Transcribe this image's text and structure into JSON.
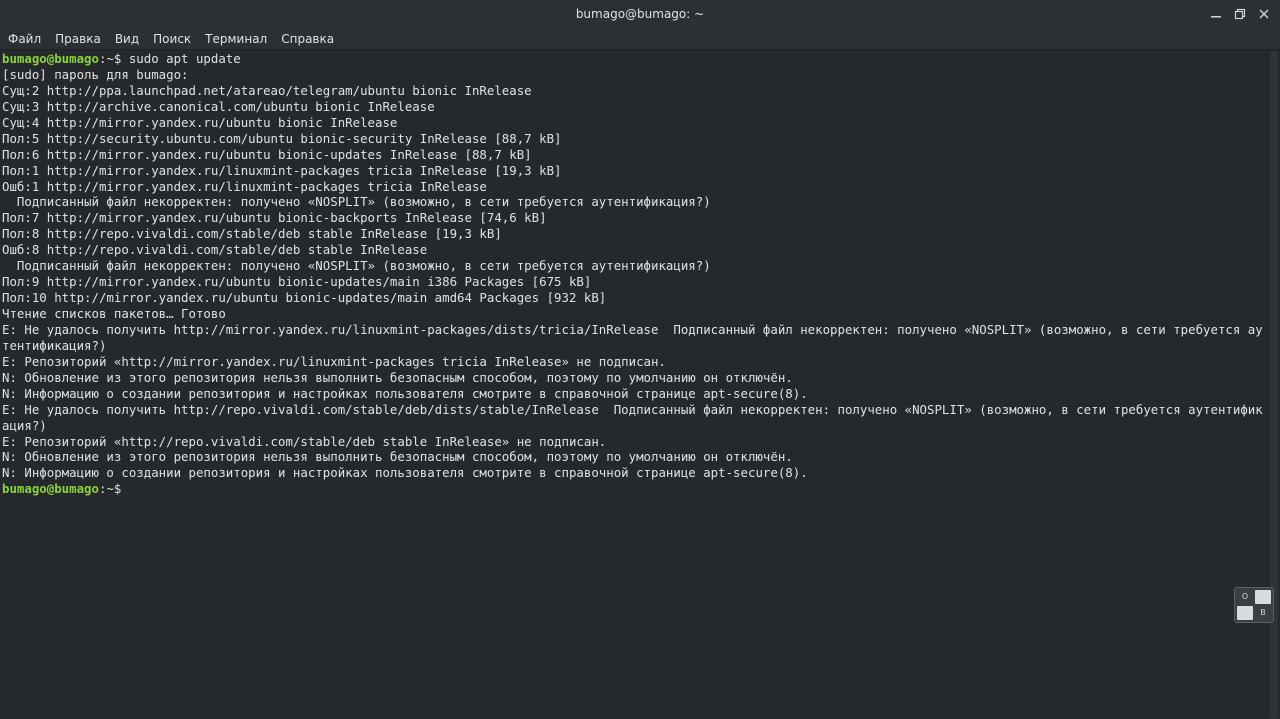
{
  "window": {
    "title": "bumago@bumago: ~"
  },
  "menu": {
    "items": [
      "Файл",
      "Правка",
      "Вид",
      "Поиск",
      "Терминал",
      "Справка"
    ]
  },
  "terminal": {
    "prompt_user": "bumago@bumago",
    "prompt_path": ":~$",
    "command": " sudo apt update",
    "output": [
      "[sudo] пароль для bumago:",
      "Сущ:2 http://ppa.launchpad.net/atareao/telegram/ubuntu bionic InRelease",
      "Сущ:3 http://archive.canonical.com/ubuntu bionic InRelease",
      "Сущ:4 http://mirror.yandex.ru/ubuntu bionic InRelease",
      "Пол:5 http://security.ubuntu.com/ubuntu bionic-security InRelease [88,7 kB]",
      "Пол:6 http://mirror.yandex.ru/ubuntu bionic-updates InRelease [88,7 kB]",
      "Пол:1 http://mirror.yandex.ru/linuxmint-packages tricia InRelease [19,3 kB]",
      "Ошб:1 http://mirror.yandex.ru/linuxmint-packages tricia InRelease",
      "  Подписанный файл некорректен: получено «NOSPLIT» (возможно, в сети требуется аутентификация?)",
      "Пол:7 http://mirror.yandex.ru/ubuntu bionic-backports InRelease [74,6 kB]",
      "Пол:8 http://repo.vivaldi.com/stable/deb stable InRelease [19,3 kB]",
      "Ошб:8 http://repo.vivaldi.com/stable/deb stable InRelease",
      "  Подписанный файл некорректен: получено «NOSPLIT» (возможно, в сети требуется аутентификация?)",
      "Пол:9 http://mirror.yandex.ru/ubuntu bionic-updates/main i386 Packages [675 kB]",
      "Пол:10 http://mirror.yandex.ru/ubuntu bionic-updates/main amd64 Packages [932 kB]",
      "Чтение списков пакетов… Готово",
      "E: Не удалось получить http://mirror.yandex.ru/linuxmint-packages/dists/tricia/InRelease  Подписанный файл некорректен: получено «NOSPLIT» (возможно, в сети требуется ау",
      "тентификация?)",
      "E: Репозиторий «http://mirror.yandex.ru/linuxmint-packages tricia InRelease» не подписан.",
      "N: Обновление из этого репозитория нельзя выполнить безопасным способом, поэтому по умолчанию он отключён.",
      "N: Информацию о создании репозитория и настройках пользователя смотрите в справочной странице apt-secure(8).",
      "E: Не удалось получить http://repo.vivaldi.com/stable/deb/dists/stable/InRelease  Подписанный файл некорректен: получено «NOSPLIT» (возможно, в сети требуется аутентифик",
      "ация?)",
      "E: Репозиторий «http://repo.vivaldi.com/stable/deb stable InRelease» не подписан.",
      "N: Обновление из этого репозитория нельзя выполнить безопасным способом, поэтому по умолчанию он отключён.",
      "N: Информацию о создании репозитория и настройках пользователя смотрите в справочной странице apt-secure(8)."
    ],
    "final_prompt_user": "bumago@bumago",
    "final_prompt_path": ":~$"
  },
  "keyboard_widget": {
    "cells": [
      "O",
      "",
      "",
      "B"
    ]
  },
  "colors": {
    "background": "#25292c",
    "foreground": "#dee2e4",
    "prompt_user": "#8ad435",
    "titlebar": "#2b3034"
  },
  "icons": {
    "minimize": "minimize-icon",
    "maximize": "maximize-icon",
    "close": "close-icon"
  }
}
